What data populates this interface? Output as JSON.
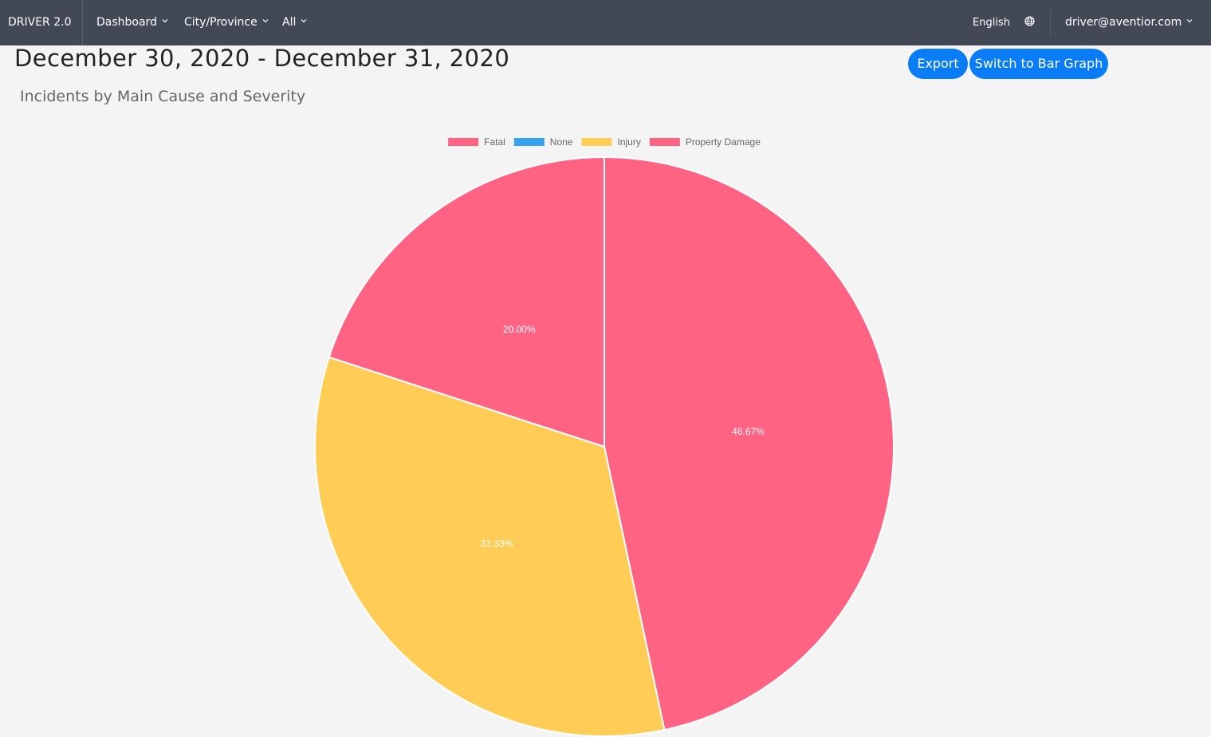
{
  "navbar": {
    "brand": "DRIVER 2.0",
    "menus": [
      {
        "label": "Dashboard"
      },
      {
        "label": "City/Province"
      },
      {
        "label": "All"
      }
    ],
    "language": "English",
    "user": "driver@aventior.com"
  },
  "page": {
    "date_range": "December 30, 2020 - December 31, 2020",
    "subtitle": "Incidents by Main Cause and Severity"
  },
  "actions": {
    "export_label": "Export",
    "switch_label": "Switch to Bar Graph"
  },
  "colors": {
    "navbar": "#434857",
    "button": "#0a7cf5",
    "fatal": "#ff6384",
    "none": "#36a2eb",
    "injury": "#ffcd56",
    "property_damage": "#ff6384"
  },
  "chart_data": {
    "type": "pie",
    "title": "",
    "legend_position": "top",
    "series": [
      {
        "name": "Fatal",
        "color": "#ff6384",
        "percent": 0,
        "label": ""
      },
      {
        "name": "None",
        "color": "#36a2eb",
        "percent": 0,
        "label": ""
      },
      {
        "name": "Property Damage",
        "color": "#ff6384",
        "percent": 46.67,
        "label": "46.67%"
      },
      {
        "name": "Injury",
        "color": "#ffcd56",
        "percent": 33.33,
        "label": "33.33%"
      },
      {
        "name": "Fatal",
        "color": "#ff6384",
        "percent": 20.0,
        "label": "20.00%"
      }
    ],
    "legend": [
      {
        "name": "Fatal",
        "color": "#ff6384"
      },
      {
        "name": "None",
        "color": "#36a2eb"
      },
      {
        "name": "Injury",
        "color": "#ffcd56"
      },
      {
        "name": "Property Damage",
        "color": "#ff6384"
      }
    ]
  }
}
